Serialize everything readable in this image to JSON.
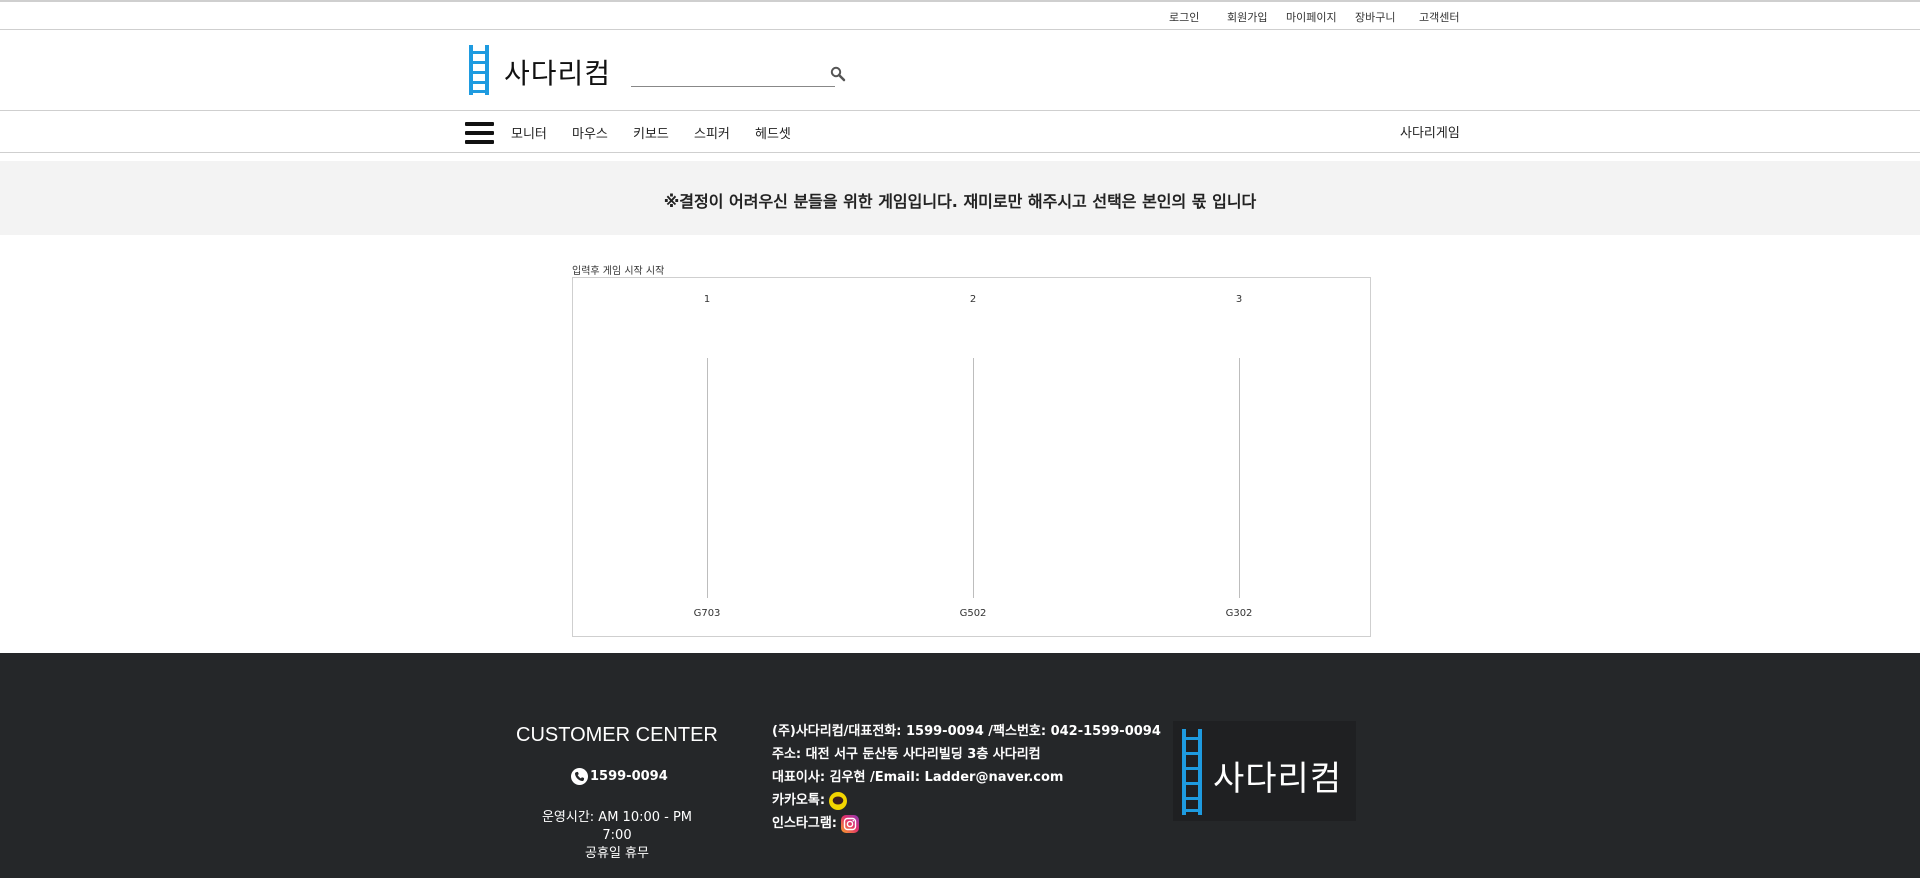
{
  "topbar": {
    "links": [
      "로그인",
      "회원가입",
      "마이페이지",
      "장바구니",
      "고객센터"
    ]
  },
  "header": {
    "logo_text": "사다리컴",
    "search_placeholder": "",
    "logo_color": "#1e9be0"
  },
  "nav": {
    "items": [
      "모니터",
      "마우스",
      "키보드",
      "스피커",
      "헤드셋"
    ],
    "right_link": "사다리게임"
  },
  "notice": {
    "text": "※결정이 어려우신 분들을 위한 게임입니다. 재미로만 해주시고 선택은 본인의 몫 입니다"
  },
  "game": {
    "caption": "입력후 게임 시작 시작",
    "players": [
      "1",
      "2",
      "3"
    ],
    "results": [
      "G703",
      "G502",
      "G302"
    ]
  },
  "footer": {
    "cc_title": "CUSTOMER CENTER",
    "cc_phone": "1599-0094",
    "cc_hours": "운영시간: AM 10:00 - PM 7:00",
    "cc_holiday": "공휴일 휴무",
    "info_line1": "(주)사다리컴/대표전화: 1599-0094 /팩스번호: 042-1599-0094",
    "info_line2": "주소: 대전 서구 둔산동 사다리빌딩 3층 사다리컴",
    "info_line3": "대표이사: 김우현 /Email: Ladder@naver.com",
    "kakao_label": "카카오톡:",
    "insta_label": "인스타그램:",
    "logo_text": "사다리컴",
    "bg_color": "#252729"
  }
}
